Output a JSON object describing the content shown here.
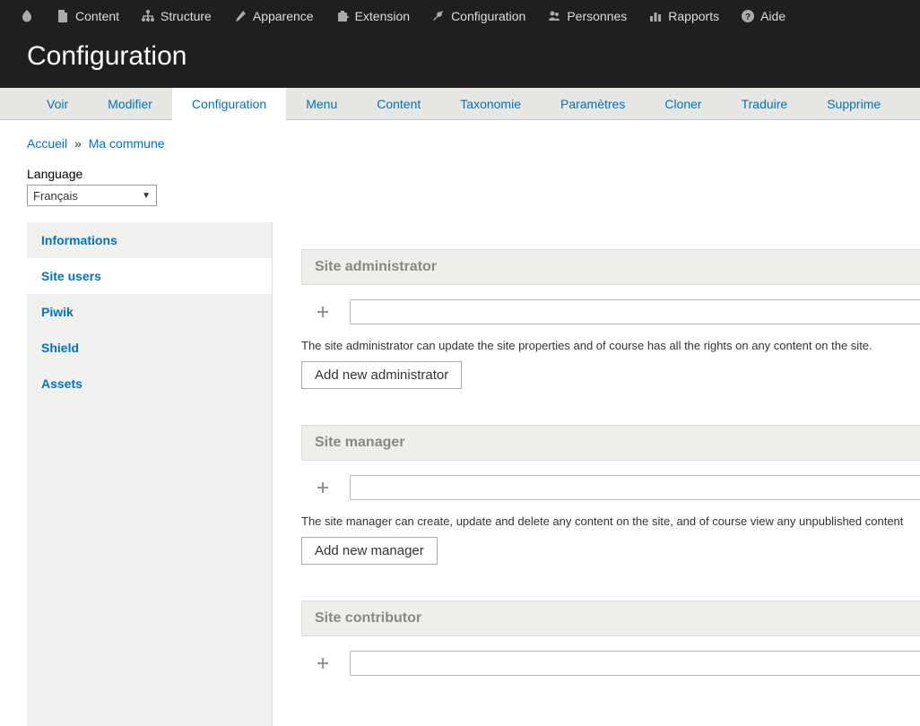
{
  "toolbar": {
    "items": [
      {
        "icon": "drupal",
        "label": ""
      },
      {
        "icon": "file",
        "label": "Content"
      },
      {
        "icon": "structure",
        "label": "Structure"
      },
      {
        "icon": "appearance",
        "label": "Apparence"
      },
      {
        "icon": "extension",
        "label": "Extension"
      },
      {
        "icon": "config",
        "label": "Configuration"
      },
      {
        "icon": "people",
        "label": "Personnes"
      },
      {
        "icon": "reports",
        "label": "Rapports"
      },
      {
        "icon": "help",
        "label": "Aide"
      }
    ]
  },
  "header": {
    "title": "Configuration"
  },
  "tabs": {
    "items": [
      {
        "label": "Voir",
        "active": false
      },
      {
        "label": "Modifier",
        "active": false
      },
      {
        "label": "Configuration",
        "active": true
      },
      {
        "label": "Menu",
        "active": false
      },
      {
        "label": "Content",
        "active": false
      },
      {
        "label": "Taxonomie",
        "active": false
      },
      {
        "label": "Paramètres",
        "active": false
      },
      {
        "label": "Cloner",
        "active": false
      },
      {
        "label": "Traduire",
        "active": false
      },
      {
        "label": "Supprime",
        "active": false
      }
    ]
  },
  "breadcrumb": {
    "home": "Accueil",
    "sep": "»",
    "current": "Ma commune"
  },
  "language": {
    "label": "Language",
    "value": "Français"
  },
  "sidebar": {
    "items": [
      {
        "label": "Informations",
        "active": false
      },
      {
        "label": "Site users",
        "active": true
      },
      {
        "label": "Piwik",
        "active": false
      },
      {
        "label": "Shield",
        "active": false
      },
      {
        "label": "Assets",
        "active": false
      }
    ]
  },
  "sections": [
    {
      "title": "Site administrator",
      "desc": "The site administrator can update the site properties and of course has all the rights on any content on the site.",
      "button": "Add new administrator"
    },
    {
      "title": "Site manager",
      "desc": "The site manager can create, update and delete any content on the site, and of course view any unpublished content",
      "button": "Add new manager"
    },
    {
      "title": "Site contributor",
      "desc": "",
      "button": ""
    }
  ]
}
